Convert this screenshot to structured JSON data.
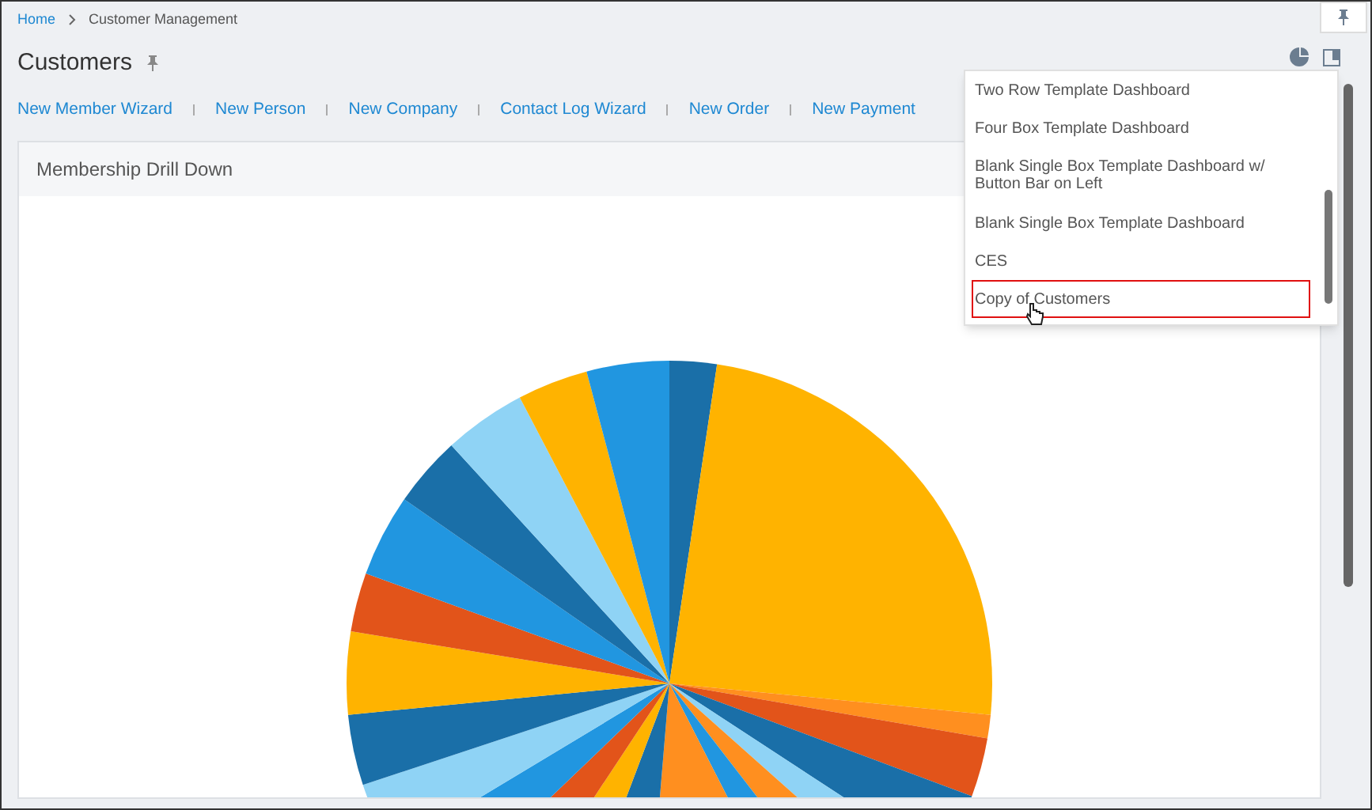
{
  "breadcrumb": [
    {
      "label": "Home",
      "link": true
    },
    {
      "label": "Customer Management",
      "link": false
    }
  ],
  "page_title": "Customers",
  "actions": [
    "New Member Wizard",
    "New Person",
    "New Company",
    "Contact Log Wizard",
    "New Order",
    "New Payment"
  ],
  "card": {
    "title": "Membership Drill Down"
  },
  "dropdown": {
    "items": [
      {
        "label": "Two Row Template Dashboard",
        "highlighted": false
      },
      {
        "label": "Four Box Template Dashboard",
        "highlighted": false
      },
      {
        "label": "Blank Single Box Template Dashboard w/ Button Bar on Left",
        "highlighted": false
      },
      {
        "label": "Blank Single Box Template Dashboard",
        "highlighted": false
      },
      {
        "label": "CES",
        "highlighted": false
      },
      {
        "label": "Copy of Customers",
        "highlighted": true
      }
    ]
  }
}
